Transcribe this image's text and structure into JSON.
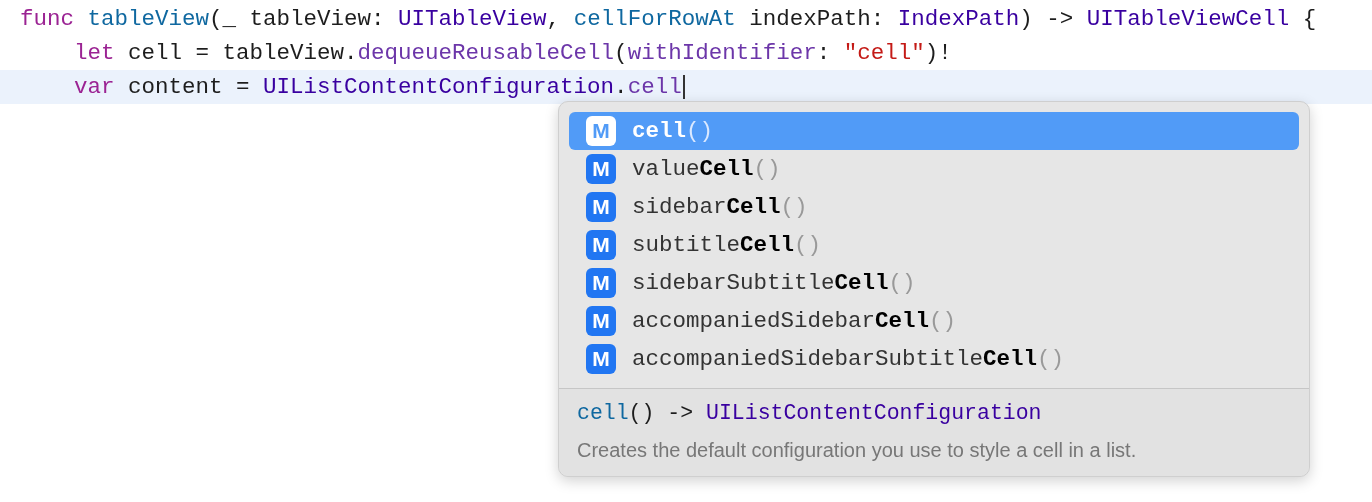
{
  "editor": {
    "lines": [
      {
        "current": false,
        "tokens": [
          {
            "kind": "keyword",
            "text": "func "
          },
          {
            "kind": "decl",
            "text": "tableView"
          },
          {
            "kind": "plain",
            "text": "(_ tableView: "
          },
          {
            "kind": "type",
            "text": "UITableView"
          },
          {
            "kind": "plain",
            "text": ", "
          },
          {
            "kind": "decl",
            "text": "cellForRowAt"
          },
          {
            "kind": "plain",
            "text": " indexPath: "
          },
          {
            "kind": "type",
            "text": "IndexPath"
          },
          {
            "kind": "plain",
            "text": ") -> "
          },
          {
            "kind": "type",
            "text": "UITableViewCell"
          },
          {
            "kind": "plain",
            "text": " {"
          }
        ],
        "children": [
          {
            "current": false,
            "tokens": [
              {
                "kind": "keyword",
                "text": "let"
              },
              {
                "kind": "plain",
                "text": " cell = tableView."
              },
              {
                "kind": "method",
                "text": "dequeueReusableCell"
              },
              {
                "kind": "plain",
                "text": "("
              },
              {
                "kind": "method",
                "text": "withIdentifier"
              },
              {
                "kind": "plain",
                "text": ": "
              },
              {
                "kind": "string",
                "text": "\"cell\""
              },
              {
                "kind": "plain",
                "text": ")!"
              }
            ]
          },
          {
            "current": true,
            "tokens": [
              {
                "kind": "keyword",
                "text": "var"
              },
              {
                "kind": "plain",
                "text": " content = "
              },
              {
                "kind": "type",
                "text": "UIListContentConfiguration"
              },
              {
                "kind": "plain",
                "text": "."
              },
              {
                "kind": "method",
                "text": "cell"
              }
            ]
          }
        ]
      }
    ]
  },
  "completion": {
    "items": [
      {
        "icon": "M",
        "selected": true,
        "parts": [
          {
            "kind": "match",
            "text": "cell"
          },
          {
            "kind": "parens",
            "text": "()"
          }
        ]
      },
      {
        "icon": "M",
        "selected": false,
        "parts": [
          {
            "kind": "plain",
            "text": "value"
          },
          {
            "kind": "match",
            "text": "Cell"
          },
          {
            "kind": "parens",
            "text": "()"
          }
        ]
      },
      {
        "icon": "M",
        "selected": false,
        "parts": [
          {
            "kind": "plain",
            "text": "sidebar"
          },
          {
            "kind": "match",
            "text": "Cell"
          },
          {
            "kind": "parens",
            "text": "()"
          }
        ]
      },
      {
        "icon": "M",
        "selected": false,
        "parts": [
          {
            "kind": "plain",
            "text": "subtitle"
          },
          {
            "kind": "match",
            "text": "Cell"
          },
          {
            "kind": "parens",
            "text": "()"
          }
        ]
      },
      {
        "icon": "M",
        "selected": false,
        "parts": [
          {
            "kind": "plain",
            "text": "sidebarSubtitle"
          },
          {
            "kind": "match",
            "text": "Cell"
          },
          {
            "kind": "parens",
            "text": "()"
          }
        ]
      },
      {
        "icon": "M",
        "selected": false,
        "parts": [
          {
            "kind": "plain",
            "text": "accompaniedSidebar"
          },
          {
            "kind": "match",
            "text": "Cell"
          },
          {
            "kind": "parens",
            "text": "()"
          }
        ]
      },
      {
        "icon": "M",
        "selected": false,
        "parts": [
          {
            "kind": "plain",
            "text": "accompaniedSidebarSubtitle"
          },
          {
            "kind": "match",
            "text": "Cell"
          },
          {
            "kind": "parens",
            "text": "()"
          }
        ]
      }
    ],
    "signature": [
      {
        "kind": "decl",
        "text": "cell"
      },
      {
        "kind": "plain",
        "text": "() -> "
      },
      {
        "kind": "type",
        "text": "UIListContentConfiguration"
      }
    ],
    "description": "Creates the default configuration you use to style a cell in a list."
  }
}
